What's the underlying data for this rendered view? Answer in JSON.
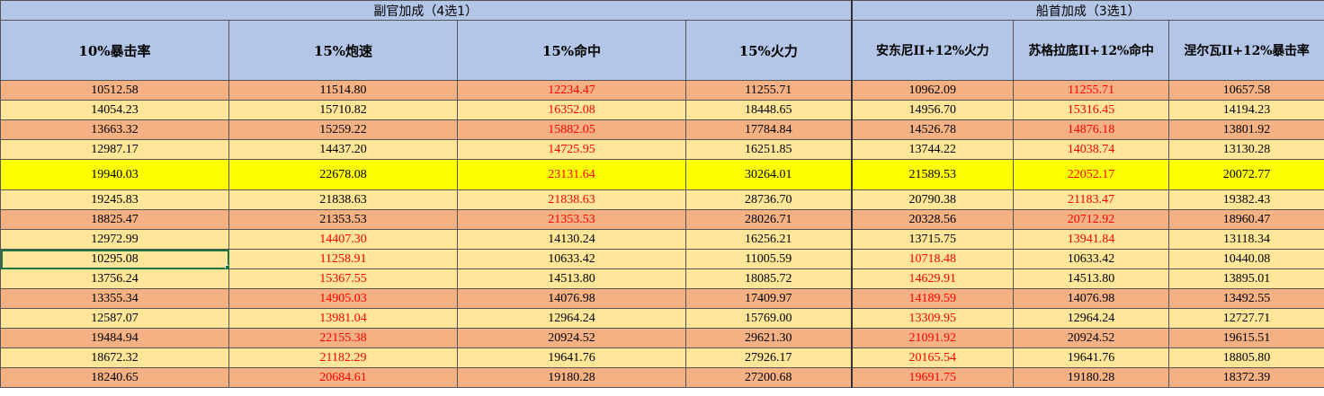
{
  "groups": {
    "left": "副官加成（4选1）",
    "right": "船首加成（3选1）"
  },
  "headers": [
    "10%暴击率",
    "15%炮速",
    "15%命中",
    "15%火力",
    "安东尼II+12%火力",
    "苏格拉底II+12%命中",
    "涅尔瓦II+12%暴击率"
  ],
  "colors": {
    "header_bg": "#b4c6e7",
    "row_salmon": "#f4b183",
    "row_light": "#ffe699",
    "row_highlight": "#ffff00",
    "red_text": "#ff0000"
  },
  "rows": [
    {
      "style": "salmon",
      "red": [
        2,
        5
      ],
      "cells": [
        "10512.58",
        "11514.80",
        "12234.47",
        "11255.71",
        "10962.09",
        "11255.71",
        "10657.58"
      ]
    },
    {
      "style": "light",
      "red": [
        2,
        5
      ],
      "cells": [
        "14054.23",
        "15710.82",
        "16352.08",
        "18448.65",
        "14956.70",
        "15316.45",
        "14194.23"
      ]
    },
    {
      "style": "salmon",
      "red": [
        2,
        5
      ],
      "cells": [
        "13663.32",
        "15259.22",
        "15882.05",
        "17784.84",
        "14526.78",
        "14876.18",
        "13801.92"
      ]
    },
    {
      "style": "light",
      "red": [
        2,
        5
      ],
      "cells": [
        "12987.17",
        "14437.20",
        "14725.95",
        "16251.85",
        "13744.22",
        "14038.74",
        "13130.28"
      ]
    },
    {
      "style": "yellow",
      "red": [
        2,
        5
      ],
      "cells": [
        "19940.03",
        "22678.08",
        "23131.64",
        "30264.01",
        "21589.53",
        "22052.17",
        "20072.77"
      ]
    },
    {
      "style": "light",
      "red": [
        2,
        5
      ],
      "cells": [
        "19245.83",
        "21838.63",
        "21838.63",
        "28736.70",
        "20790.38",
        "21183.47",
        "19382.43"
      ]
    },
    {
      "style": "salmon",
      "red": [
        2,
        5
      ],
      "cells": [
        "18825.47",
        "21353.53",
        "21353.53",
        "28026.71",
        "20328.56",
        "20712.92",
        "18960.47"
      ]
    },
    {
      "style": "light",
      "red": [
        1,
        5
      ],
      "cells": [
        "12972.99",
        "14407.30",
        "14130.24",
        "16256.21",
        "13715.75",
        "13941.84",
        "13118.34"
      ]
    },
    {
      "style": "light",
      "red": [
        1,
        4
      ],
      "selected": 0,
      "cells": [
        "10295.08",
        "11258.91",
        "10633.42",
        "11005.59",
        "10718.48",
        "10633.42",
        "10440.08"
      ]
    },
    {
      "style": "light",
      "red": [
        1,
        4
      ],
      "cells": [
        "13756.24",
        "15367.55",
        "14513.80",
        "18085.72",
        "14629.91",
        "14513.80",
        "13895.01"
      ]
    },
    {
      "style": "salmon",
      "red": [
        1,
        4
      ],
      "cells": [
        "13355.34",
        "14905.03",
        "14076.98",
        "17409.97",
        "14189.59",
        "14076.98",
        "13492.55"
      ]
    },
    {
      "style": "light",
      "red": [
        1,
        4
      ],
      "cells": [
        "12587.07",
        "13981.04",
        "12964.24",
        "15769.00",
        "13309.95",
        "12964.24",
        "12727.71"
      ]
    },
    {
      "style": "salmon",
      "red": [
        1,
        4
      ],
      "cells": [
        "19484.94",
        "22155.38",
        "20924.52",
        "29621.30",
        "21091.92",
        "20924.52",
        "19615.51"
      ]
    },
    {
      "style": "light",
      "red": [
        1,
        4
      ],
      "cells": [
        "18672.32",
        "21182.29",
        "19641.76",
        "27926.17",
        "20165.54",
        "19641.76",
        "18805.80"
      ]
    },
    {
      "style": "salmon",
      "red": [
        1,
        4
      ],
      "cells": [
        "18240.65",
        "20684.61",
        "19180.28",
        "27200.68",
        "19691.75",
        "19180.28",
        "18372.39"
      ]
    }
  ]
}
